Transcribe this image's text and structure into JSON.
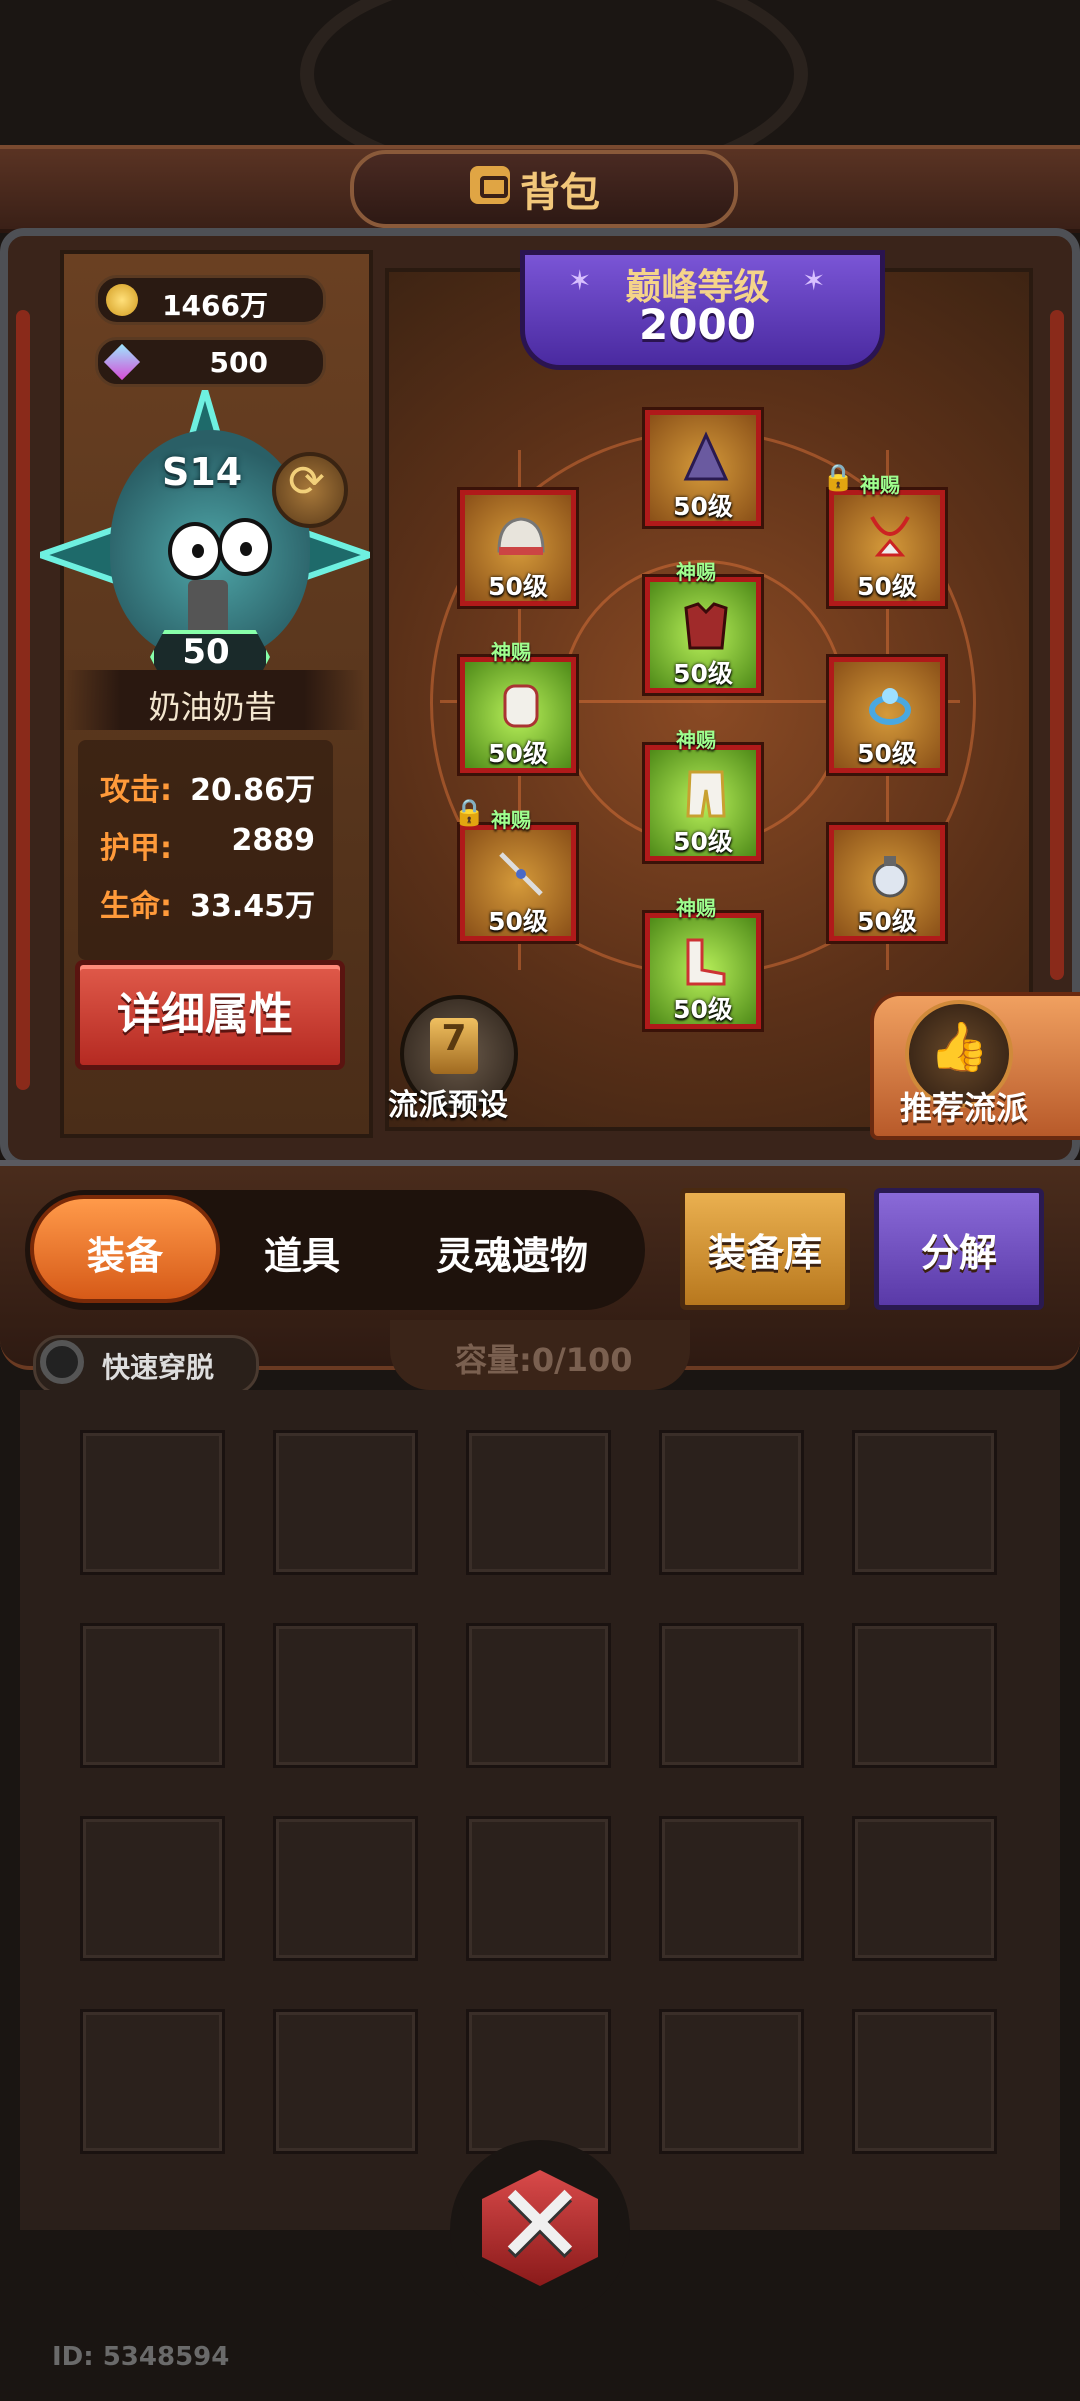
{
  "header": {
    "title": "背包",
    "icon": "backpack-icon"
  },
  "currency": {
    "gold": "1466万",
    "gems": "500"
  },
  "hero": {
    "season": "S14",
    "level": "50",
    "name": "奶油奶昔"
  },
  "stats": [
    {
      "label": "攻击:",
      "value": "20.86万"
    },
    {
      "label": "护甲:",
      "value": "2889"
    },
    {
      "label": "生命:",
      "value": "33.45万"
    }
  ],
  "detail_button": "详细属性",
  "peak": {
    "label": "巅峰等级",
    "value": "2000"
  },
  "equipment": [
    {
      "name": "helmet",
      "level": "50级",
      "tag": "",
      "locked": false,
      "color": "gold"
    },
    {
      "name": "hat",
      "level": "50级",
      "tag": "",
      "locked": false,
      "color": "gold"
    },
    {
      "name": "necklace",
      "level": "50级",
      "tag": "神赐",
      "locked": true,
      "color": "gold"
    },
    {
      "name": "chest-armor",
      "level": "50级",
      "tag": "神赐",
      "locked": false,
      "color": "green"
    },
    {
      "name": "gloves",
      "level": "50级",
      "tag": "神赐",
      "locked": false,
      "color": "green"
    },
    {
      "name": "ring",
      "level": "50级",
      "tag": "",
      "locked": false,
      "color": "gold"
    },
    {
      "name": "pants",
      "level": "50级",
      "tag": "神赐",
      "locked": false,
      "color": "green"
    },
    {
      "name": "weapon",
      "level": "50级",
      "tag": "神赐",
      "locked": true,
      "color": "gold"
    },
    {
      "name": "pouch",
      "level": "50级",
      "tag": "",
      "locked": false,
      "color": "gold"
    },
    {
      "name": "boots",
      "level": "50级",
      "tag": "神赐",
      "locked": false,
      "color": "green"
    }
  ],
  "preset": {
    "label": "流派预设",
    "icon_text": "7"
  },
  "recommend": {
    "label": "推荐流派"
  },
  "tabs": [
    "装备",
    "道具",
    "灵魂遗物"
  ],
  "buttons": {
    "library": "装备库",
    "decompose": "分解"
  },
  "quick_toggle": "快速穿脱",
  "capacity": {
    "label": "容量:",
    "value": "0/100"
  },
  "uid": "ID: 5348594",
  "colors": {
    "slot_border": "#b01a1a",
    "gold_slot": "#d59a3a",
    "green_slot": "#b8f05a",
    "accent_orange": "#ff9a4a",
    "purple": "#7a55d6"
  }
}
